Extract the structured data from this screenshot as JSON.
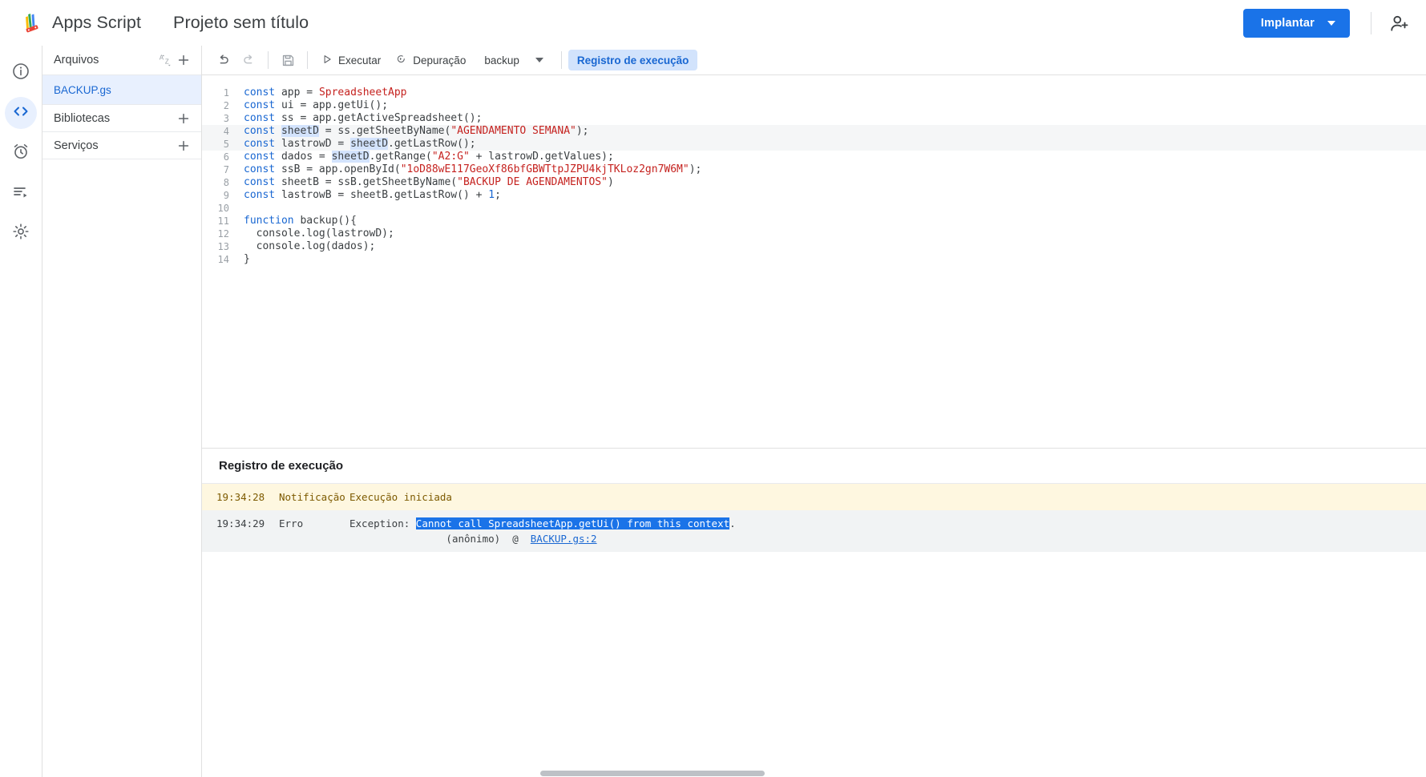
{
  "header": {
    "brand": "Apps Script",
    "project_title": "Projeto sem título",
    "deploy_label": "Implantar",
    "logo_icon": "apps-script-logo",
    "caret_icon": "chevron-down-icon",
    "share_icon": "add-person-icon",
    "accent_color": "#1a73e8"
  },
  "rail": {
    "items": [
      {
        "icon": "info-icon",
        "name": "overview",
        "active": false
      },
      {
        "icon": "code-icon",
        "name": "editor",
        "active": true
      },
      {
        "icon": "alarm-clock-icon",
        "name": "triggers",
        "active": false
      },
      {
        "icon": "executions-icon",
        "name": "executions",
        "active": false
      },
      {
        "icon": "gear-icon",
        "name": "settings",
        "active": false
      }
    ]
  },
  "files_panel": {
    "header_title": "Arquivos",
    "sort_icon": "sort-az-icon",
    "add_icon": "plus-icon",
    "files": [
      {
        "name": "BACKUP.gs",
        "selected": true
      }
    ],
    "sections": [
      {
        "label": "Bibliotecas",
        "add_icon": "plus-icon"
      },
      {
        "label": "Serviços",
        "add_icon": "plus-icon"
      }
    ]
  },
  "toolbar": {
    "undo_icon": "undo-icon",
    "redo_icon": "redo-icon",
    "save_icon": "save-icon",
    "run_label": "Executar",
    "run_icon": "play-icon",
    "debug_label": "Depuração",
    "debug_icon": "debug-icon",
    "function_name": "backup",
    "function_caret_icon": "chevron-down-icon",
    "log_tab_label": "Registro de execução"
  },
  "code": {
    "lines": [
      {
        "n": "1",
        "tokens": [
          {
            "t": "kw",
            "v": "const"
          },
          {
            "t": "pl",
            "v": " app = "
          },
          {
            "t": "cls",
            "v": "SpreadsheetApp"
          }
        ]
      },
      {
        "n": "2",
        "tokens": [
          {
            "t": "kw",
            "v": "const"
          },
          {
            "t": "pl",
            "v": " ui = app.getUi();"
          }
        ]
      },
      {
        "n": "3",
        "tokens": [
          {
            "t": "kw",
            "v": "const"
          },
          {
            "t": "pl",
            "v": " ss = app.getActiveSpreadsheet();"
          }
        ]
      },
      {
        "n": "4",
        "hl": true,
        "tokens": [
          {
            "t": "kw",
            "v": "const"
          },
          {
            "t": "pl",
            "v": " "
          },
          {
            "t": "occ",
            "v": "sheetD"
          },
          {
            "t": "pl",
            "v": " = ss.getSheetByName("
          },
          {
            "t": "str",
            "v": "\"AGENDAMENTO SEMANA\""
          },
          {
            "t": "pl",
            "v": ");"
          }
        ]
      },
      {
        "n": "5",
        "hl": true,
        "tokens": [
          {
            "t": "kw",
            "v": "const"
          },
          {
            "t": "pl",
            "v": " lastrowD = "
          },
          {
            "t": "occ",
            "v": "sheetD"
          },
          {
            "t": "pl",
            "v": ".getLastRow();"
          }
        ]
      },
      {
        "n": "6",
        "tokens": [
          {
            "t": "kw",
            "v": "const"
          },
          {
            "t": "pl",
            "v": " dados = "
          },
          {
            "t": "occ",
            "v": "sheetD"
          },
          {
            "t": "pl",
            "v": ".getRange("
          },
          {
            "t": "str",
            "v": "\"A2:G\""
          },
          {
            "t": "pl",
            "v": " + lastrowD.getValues);"
          }
        ]
      },
      {
        "n": "7",
        "tokens": [
          {
            "t": "kw",
            "v": "const"
          },
          {
            "t": "pl",
            "v": " ssB = app.openById("
          },
          {
            "t": "str",
            "v": "\"1oD88wE117GeoXf86bfGBWTtpJZPU4kjTKLoz2gn7W6M\""
          },
          {
            "t": "pl",
            "v": ");"
          }
        ]
      },
      {
        "n": "8",
        "tokens": [
          {
            "t": "kw",
            "v": "const"
          },
          {
            "t": "pl",
            "v": " sheetB = ssB.getSheetByName("
          },
          {
            "t": "str",
            "v": "\"BACKUP DE AGENDAMENTOS\""
          },
          {
            "t": "pl",
            "v": ")"
          }
        ]
      },
      {
        "n": "9",
        "tokens": [
          {
            "t": "kw",
            "v": "const"
          },
          {
            "t": "pl",
            "v": " lastrowB = sheetB.getLastRow() + "
          },
          {
            "t": "num",
            "v": "1"
          },
          {
            "t": "pl",
            "v": ";"
          }
        ]
      },
      {
        "n": "10",
        "tokens": [
          {
            "t": "pl",
            "v": ""
          }
        ]
      },
      {
        "n": "11",
        "tokens": [
          {
            "t": "kw",
            "v": "function"
          },
          {
            "t": "pl",
            "v": " backup(){"
          }
        ]
      },
      {
        "n": "12",
        "tokens": [
          {
            "t": "pl",
            "v": "  console.log(lastrowD);"
          }
        ]
      },
      {
        "n": "13",
        "tokens": [
          {
            "t": "pl",
            "v": "  console.log(dados);"
          }
        ]
      },
      {
        "n": "14",
        "tokens": [
          {
            "t": "pl",
            "v": "}"
          }
        ]
      }
    ]
  },
  "log": {
    "title": "Registro de execução",
    "rows": [
      {
        "type": "notice",
        "time": "19:34:28",
        "severity": "Notificação",
        "message": "Execução iniciada"
      },
      {
        "type": "error",
        "time": "19:34:29",
        "severity": "Erro",
        "message_prefix": "Exception: ",
        "message_selected": "Cannot call SpreadsheetApp.getUi() from this context",
        "message_suffix": ".",
        "stack_prefix": "(anônimo)  @  ",
        "stack_link": "BACKUP.gs:2"
      }
    ]
  }
}
